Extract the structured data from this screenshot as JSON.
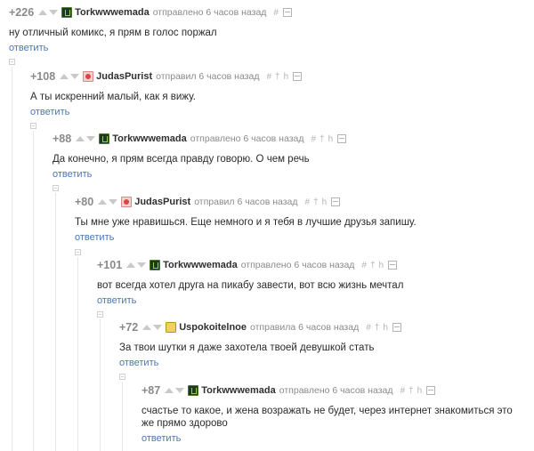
{
  "comments": [
    {
      "rating": "+226",
      "author": "Torkwwwemada",
      "meta": "отправлено 6 часов назад",
      "icons": [
        "#"
      ],
      "text": "ну отличный комикс, я прям в голос поржал",
      "reply": "ответить"
    },
    {
      "rating": "+108",
      "author": "JudasPurist",
      "meta": "отправил 6 часов назад",
      "icons": [
        "#",
        "†",
        "h"
      ],
      "text": "А ты искренний малый, как я вижу.",
      "reply": "ответить"
    },
    {
      "rating": "+88",
      "author": "Torkwwwemada",
      "meta": "отправлено 6 часов назад",
      "icons": [
        "#",
        "†",
        "h"
      ],
      "text": "Да конечно, я прям всегда правду говорю. О чем речь",
      "reply": "ответить"
    },
    {
      "rating": "+80",
      "author": "JudasPurist",
      "meta": "отправил 6 часов назад",
      "icons": [
        "#",
        "†",
        "h"
      ],
      "text": "Ты мне уже нравишься. Еще немного и я тебя в лучшие друзья запишу.",
      "reply": "ответить"
    },
    {
      "rating": "+101",
      "author": "Torkwwwemada",
      "meta": "отправлено 6 часов назад",
      "icons": [
        "#",
        "†",
        "h"
      ],
      "text": "вот всегда хотел друга на пикабу завести, вот всю жизнь мечтал",
      "reply": "ответить"
    },
    {
      "rating": "+72",
      "author": "Uspokoitelnoe",
      "meta": "отправила 6 часов назад",
      "icons": [
        "#",
        "†",
        "h"
      ],
      "text": "За твои шутки я даже захотела твоей девушкой стать",
      "reply": "ответить"
    },
    {
      "rating": "+87",
      "author": "Torkwwwemada",
      "meta": "отправлено 6 часов назад",
      "icons": [
        "#",
        "†",
        "h"
      ],
      "text": "счастье то какое, и жена возражать не будет, через интернет знакомиться это же прямо здорово",
      "reply": "ответить"
    }
  ],
  "icon_names": {
    "#": "link-icon",
    "†": "pin-icon",
    "h": "history-icon"
  }
}
